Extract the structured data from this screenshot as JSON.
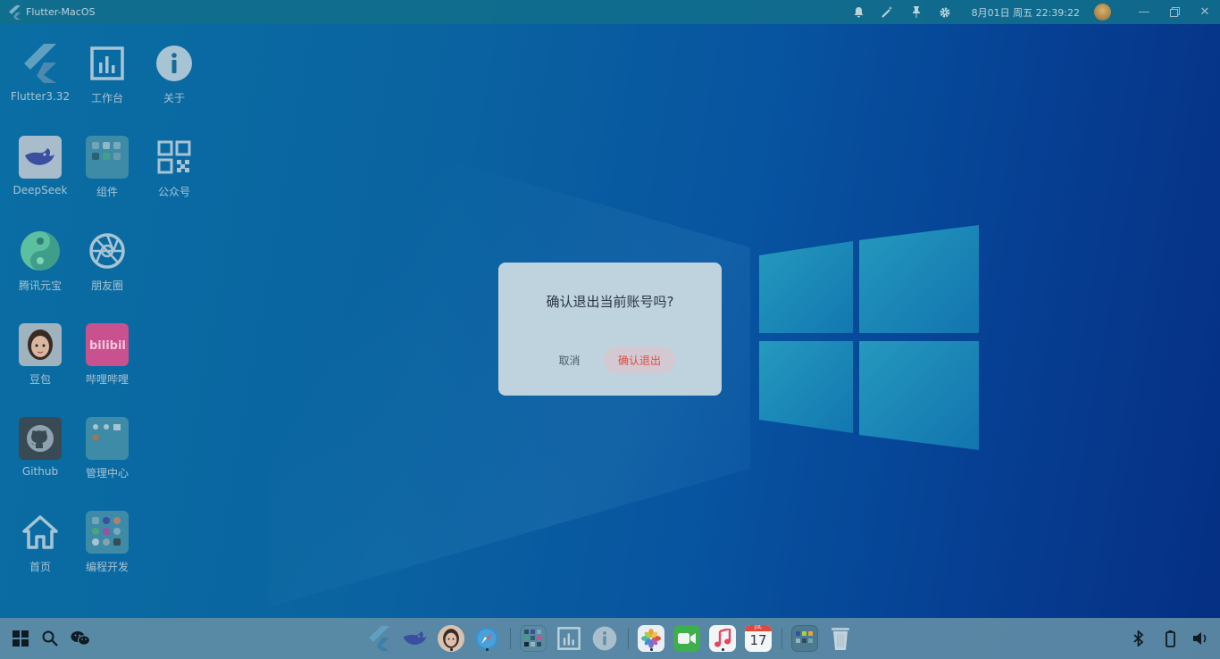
{
  "window": {
    "title": "Flutter-MacOS"
  },
  "topbar": {
    "icons": [
      "bell-icon",
      "magic-wand-icon",
      "pin-icon",
      "gear-icon"
    ],
    "clock": "8月01日 周五 22:39:22"
  },
  "desktop": {
    "icons": [
      {
        "name": "Flutter3.32",
        "icon": "flutter-logo"
      },
      {
        "name": "工作台",
        "icon": "chart-icon"
      },
      {
        "name": "关于",
        "icon": "info-icon"
      },
      {
        "name": "DeepSeek",
        "icon": "deepseek-logo"
      },
      {
        "name": "组件",
        "icon": "folder-icon"
      },
      {
        "name": "公众号",
        "icon": "qrcode-icon"
      },
      {
        "name": "腾讯元宝",
        "icon": "yuanbao-logo"
      },
      {
        "name": "朋友圈",
        "icon": "aperture-icon"
      },
      {
        "name": "豆包",
        "icon": "doubao-avatar"
      },
      {
        "name": "哔哩哔哩",
        "icon": "bilibili-logo"
      },
      {
        "name": "Github",
        "icon": "github-logo"
      },
      {
        "name": "管理中心",
        "icon": "folder-icon"
      },
      {
        "name": "首页",
        "icon": "home-icon"
      },
      {
        "name": "编程开发",
        "icon": "folder-icon"
      }
    ]
  },
  "dialog": {
    "message": "确认退出当前账号吗?",
    "cancel_label": "取消",
    "confirm_label": "确认退出"
  },
  "taskbar": {
    "left": [
      "windows-start-icon",
      "search-icon",
      "wechat-icon"
    ],
    "dock": [
      "flutter-logo",
      "deepseek-logo",
      "doubao-avatar",
      "safari-icon",
      "folder-icon",
      "chart-icon",
      "info-icon",
      "photos-icon",
      "facetime-icon",
      "music-icon",
      "calendar-icon",
      "folder-icon",
      "trash-icon"
    ],
    "calendar_day": "17",
    "calendar_month": "JUL",
    "right": [
      "bluetooth-icon",
      "battery-icon",
      "volume-icon"
    ]
  },
  "colors": {
    "accent": "#e04b3f",
    "dialog_bg": "#bfd3df",
    "taskbar": "#5f8ca5"
  }
}
